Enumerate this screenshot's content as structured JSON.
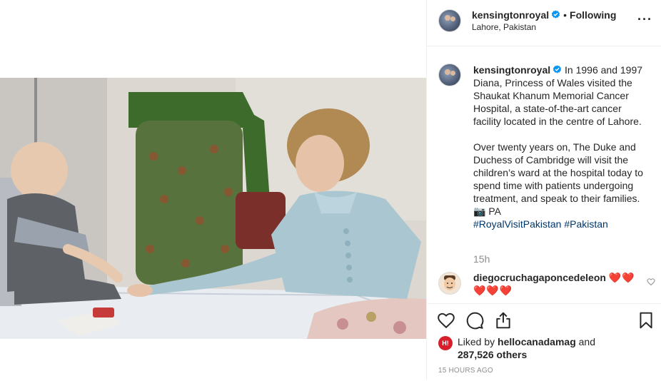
{
  "post": {
    "username": "kensingtonroyal",
    "follow_status": "Following",
    "location": "Lahore, Pakistan",
    "more_icon": "more-options-icon",
    "media": {
      "icon_name": "photo",
      "colors": {
        "wall": "#d9d6d0",
        "bed": "#e8ebf0",
        "jacket": "#a9c8d4",
        "green_dress": "#4e6b3c",
        "scarf": "#3b6e2e",
        "toy": "#c73a3a"
      }
    },
    "caption": {
      "username": "kensingtonroyal",
      "paragraph1": "In 1996 and 1997 Diana, Princess of Wales visited the Shaukat Khanum Memorial Cancer Hospital, a state-of-the-art cancer facility located in the centre of Lahore.",
      "paragraph2": "Over twenty years on, The Duke and Duchess of Cambridge will visit the children’s ward at the hospital today to spend time with patients undergoing treatment, and speak to their families. 📷 PA",
      "hashtags": "#RoyalVisitPakistan #Pakistan",
      "time": "15h"
    },
    "comment": {
      "username": "diegocruchagaponcedeleon",
      "text": "❤️❤️❤️❤️❤️"
    },
    "likes": {
      "liked_by_prefix": "Liked by",
      "liked_by_user": "hellocanadamag",
      "and": "and",
      "others": "287,526 others",
      "avatar_text": "H!"
    },
    "posted": "15 HOURS AGO",
    "accent_color": "#0095f6",
    "link_color": "#00376b"
  }
}
